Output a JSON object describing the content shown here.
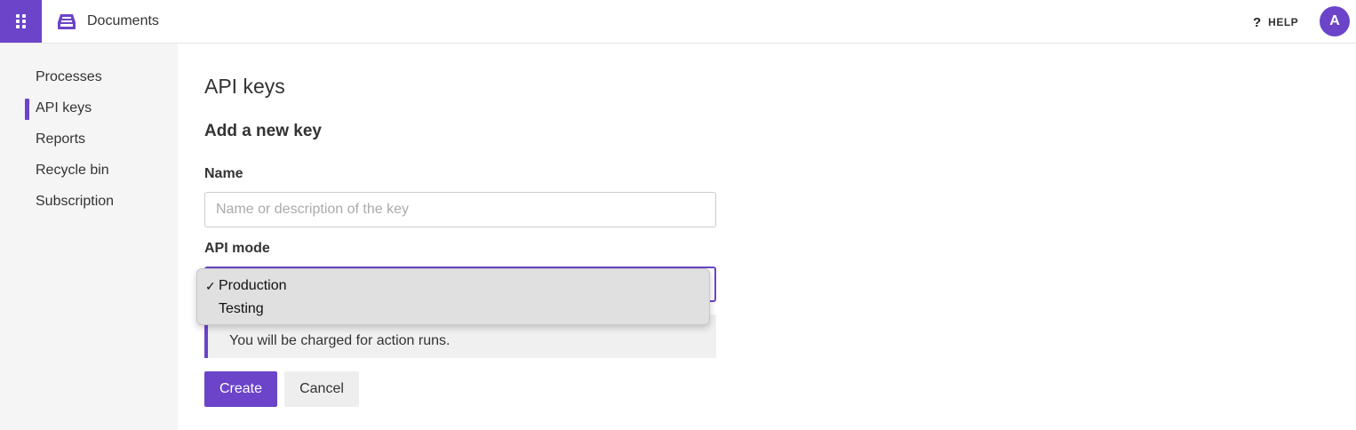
{
  "header": {
    "app_name": "Documents",
    "help_label": "HELP",
    "avatar_initial": "A",
    "accent_color": "#6b44c9"
  },
  "sidebar": {
    "items": [
      {
        "label": "Processes"
      },
      {
        "label": "API keys",
        "active": true
      },
      {
        "label": "Reports"
      },
      {
        "label": "Recycle bin"
      },
      {
        "label": "Subscription"
      }
    ]
  },
  "main": {
    "page_title": "API keys",
    "form_title": "Add a new key",
    "name_label": "Name",
    "name_placeholder": "Name or description of the key",
    "name_value": "",
    "mode_label": "API mode",
    "mode_selected": "Production",
    "info_text": "You will be charged for action runs.",
    "create_label": "Create",
    "cancel_label": "Cancel"
  },
  "dropdown": {
    "options": [
      {
        "label": "Production",
        "selected": true,
        "check": "✓"
      },
      {
        "label": "Testing",
        "selected": false,
        "check": ""
      }
    ]
  }
}
